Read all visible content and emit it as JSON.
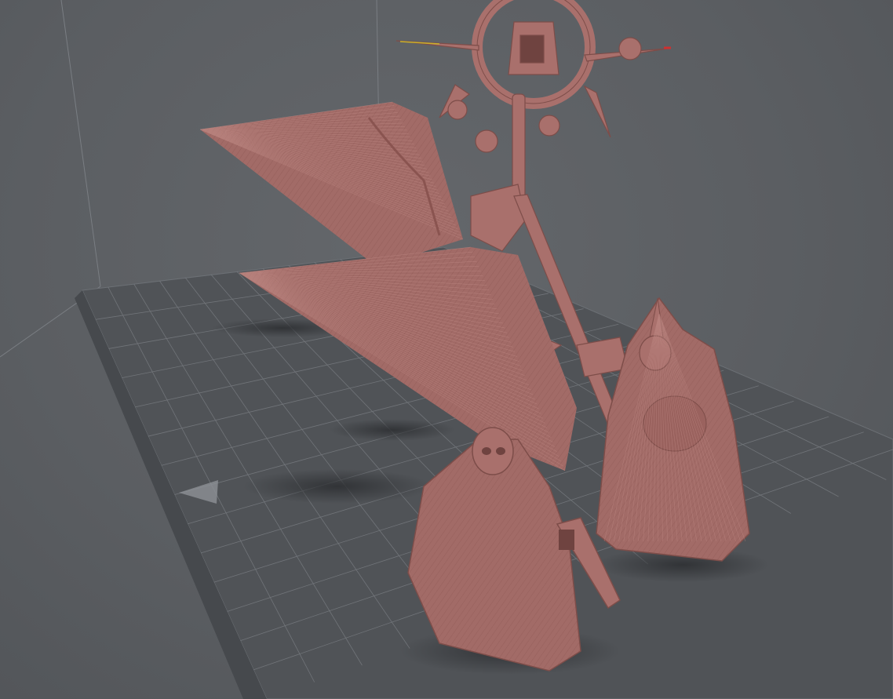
{
  "scene": {
    "background_color": "#5b5e62",
    "grid_color": "#8d9196",
    "build_plate_color": "#505357",
    "model_color": "#a9706c",
    "model_shadow_color": "#2f3134",
    "axis_x_color": "#d03030",
    "axis_y_color": "#c9b22a"
  },
  "objects": [
    {
      "id": "chaos-star-banner",
      "kind": "model"
    },
    {
      "id": "upper-back-support-mesh",
      "kind": "support-structure"
    },
    {
      "id": "lower-front-support-mesh",
      "kind": "support-structure"
    },
    {
      "id": "cloaked-figure-with-pistol",
      "kind": "model"
    },
    {
      "id": "cloaked-figure-with-sword",
      "kind": "model"
    }
  ]
}
